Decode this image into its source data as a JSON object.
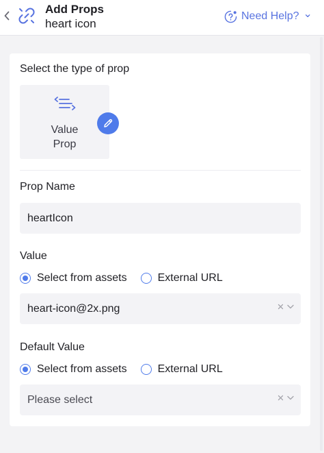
{
  "header": {
    "title": "Add Props",
    "subtitle": "heart icon",
    "help_label": "Need Help?",
    "help_chevron": "⌄"
  },
  "prop_type": {
    "section_label": "Select the type of prop",
    "card_label": "Value\nProp",
    "icon": "value-lines-icon"
  },
  "prop_name": {
    "label": "Prop Name",
    "value": "heartIcon"
  },
  "value_section": {
    "label": "Value",
    "options": [
      {
        "label": "Select from assets",
        "checked": true
      },
      {
        "label": "External URL",
        "checked": false
      }
    ],
    "selected": "heart-icon@2x.png"
  },
  "default_value_section": {
    "label": "Default Value",
    "options": [
      {
        "label": "Select from assets",
        "checked": true
      },
      {
        "label": "External URL",
        "checked": false
      }
    ],
    "placeholder": "Please select"
  },
  "colors": {
    "accent": "#4f7bea",
    "help_text": "#5873e0",
    "field_bg": "#f3f3f6"
  }
}
